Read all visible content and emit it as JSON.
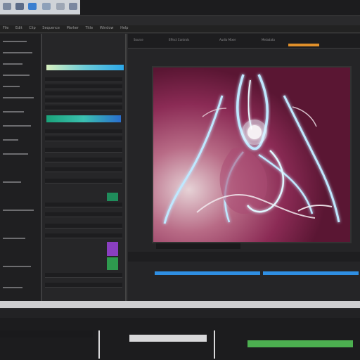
{
  "topbar": {
    "icons": [
      "app-icon",
      "window-icon",
      "tools-icon",
      "layers-icon",
      "settings-icon",
      "export-icon"
    ]
  },
  "menubar": {
    "items": [
      "File",
      "Edit",
      "Clip",
      "Sequence",
      "Marker",
      "Title",
      "Window",
      "Help"
    ]
  },
  "viewer": {
    "toolbar_items": [
      "Source",
      "Effect Controls",
      "Audio Mixer",
      "Metadata"
    ],
    "timecode": ""
  },
  "colors": {
    "accent_orange": "#e0902a",
    "accent_blue": "#2f8fe3",
    "accent_green": "#4caf50",
    "accent_purple": "#a45fd6",
    "glow_cyan": "#bfe8ff"
  }
}
